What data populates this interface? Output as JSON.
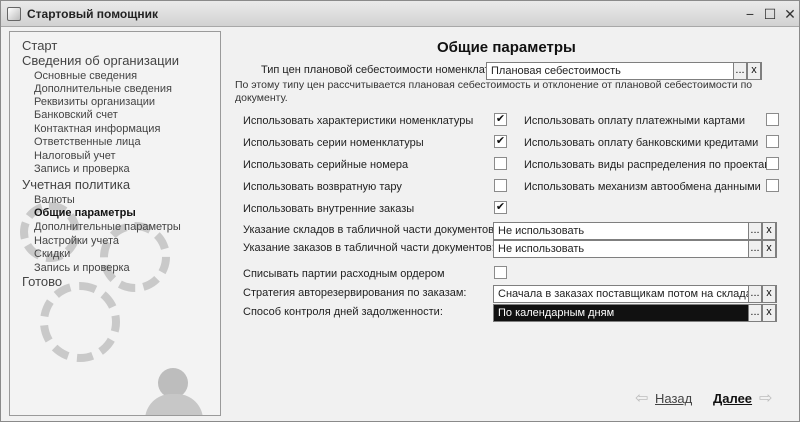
{
  "window": {
    "title": "Стартовый помощник"
  },
  "sidebar": {
    "sections": [
      {
        "label": "Старт"
      },
      {
        "label": "Сведения об организации"
      },
      {
        "label": "Учетная политика"
      },
      {
        "label": "Готово"
      }
    ],
    "org_items": [
      {
        "label": "Основные сведения"
      },
      {
        "label": "Дополнительные сведения"
      },
      {
        "label": "Реквизиты организации"
      },
      {
        "label": "Банковский счет"
      },
      {
        "label": "Контактная информация"
      },
      {
        "label": "Ответственные лица"
      },
      {
        "label": "Налоговый учет"
      },
      {
        "label": "Запись и проверка"
      }
    ],
    "policy_items": [
      {
        "label": "Валюты"
      },
      {
        "label": "Общие параметры",
        "active": true
      },
      {
        "label": "Дополнительные параметры"
      },
      {
        "label": "Настройки учета"
      },
      {
        "label": "Скидки"
      },
      {
        "label": "Запись и проверка"
      }
    ]
  },
  "main": {
    "heading": "Общие параметры",
    "price_type_label": "Тип цен плановой себестоимости номенклатуры:",
    "price_type_value": "Плановая себестоимость",
    "hint": "По этому типу цен рассчитывается плановая себестоимость и отклонение от плановой себестоимости по документу.",
    "left_checks": [
      {
        "label": "Использовать характеристики номенклатуры",
        "checked": true,
        "mark": "✔"
      },
      {
        "label": "Использовать серии номенклатуры",
        "checked": true,
        "mark": "✔"
      },
      {
        "label": "Использовать серийные номера",
        "checked": false,
        "mark": ""
      },
      {
        "label": "Использовать возвратную тару",
        "checked": false,
        "mark": ""
      },
      {
        "label": "Использовать внутренние заказы",
        "checked": true,
        "mark": "✔"
      }
    ],
    "right_checks": [
      {
        "label": "Использовать оплату платежными картами",
        "checked": false,
        "mark": ""
      },
      {
        "label": "Использовать оплату банковскими кредитами",
        "checked": false,
        "mark": ""
      },
      {
        "label": "Использовать виды распределения по проектам",
        "checked": false,
        "mark": ""
      },
      {
        "label": "Использовать механизм автообмена данными",
        "checked": false,
        "mark": ""
      }
    ],
    "warehouse_label": "Указание складов в табличной части документов:",
    "warehouse_value": "Не использовать",
    "orders_label": "Указание заказов в табличной части документов:",
    "orders_value": "Не использовать",
    "writeoff_label": "Списывать партии расходным ордером",
    "writeoff_checked": false,
    "writeoff_mark": "",
    "strategy_label": "Стратегия авторезервирования по заказам:",
    "strategy_value": "Сначала в заказах поставщикам потом на складах",
    "debt_label": "Способ контроля дней задолженности:",
    "debt_value": "По календарным дням"
  },
  "footer": {
    "back_label": "Назад",
    "next_label": "Далее"
  },
  "field_buttons": {
    "select": "...",
    "clear": "x"
  },
  "icons": {
    "back": "arrow-left-icon",
    "next": "arrow-right-icon",
    "minimize": "minimize-icon",
    "maximize": "maximize-icon",
    "close": "close-icon"
  }
}
